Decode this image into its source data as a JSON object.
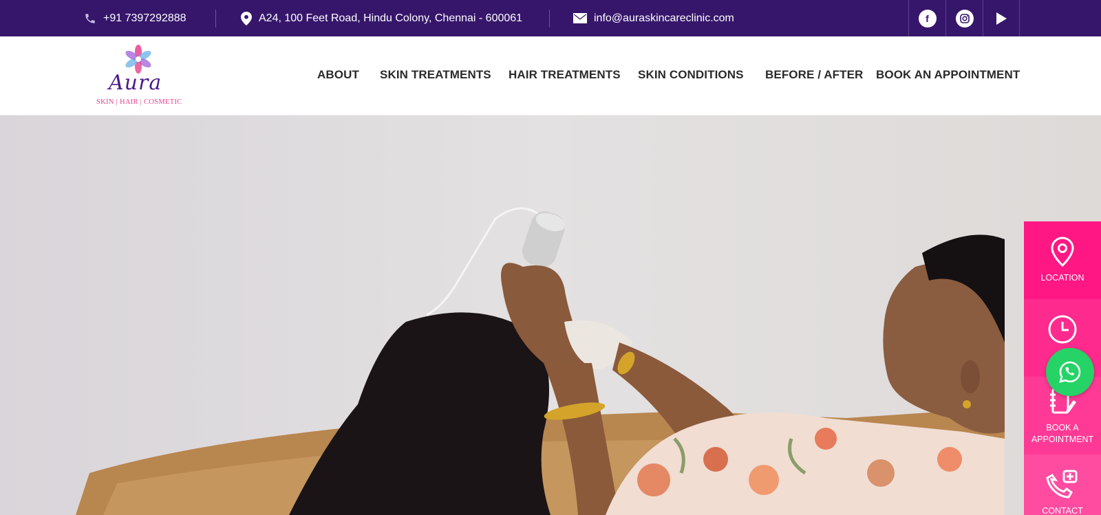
{
  "topbar": {
    "phone": "+91 7397292888",
    "address": "A24, 100 Feet Road, Hindu Colony, Chennai - 600061",
    "email": "info@auraskincareclinic.com",
    "social": [
      {
        "icon": "facebook-icon",
        "glyph": "f"
      },
      {
        "icon": "instagram-icon",
        "glyph": ""
      },
      {
        "icon": "youtube-icon",
        "glyph": ""
      }
    ]
  },
  "logo": {
    "word": "Aura",
    "tagline": "SKIN | HAIR | COSMETIC"
  },
  "nav": {
    "items": [
      "ABOUT",
      "SKIN TREATMENTS",
      "HAIR TREATMENTS",
      "SKIN CONDITIONS",
      "BEFORE / AFTER",
      "BOOK AN APPOINTMENT"
    ]
  },
  "side_panel": {
    "location": "LOCATION",
    "clinic_timings": "CL",
    "book_line1": "BOOK A",
    "book_line2": "APPOINTMENT",
    "contact": "CONTACT"
  },
  "colors": {
    "topbar_bg": "#36166b",
    "panel_pink": "#ff1784",
    "whatsapp_green": "#25d366"
  }
}
